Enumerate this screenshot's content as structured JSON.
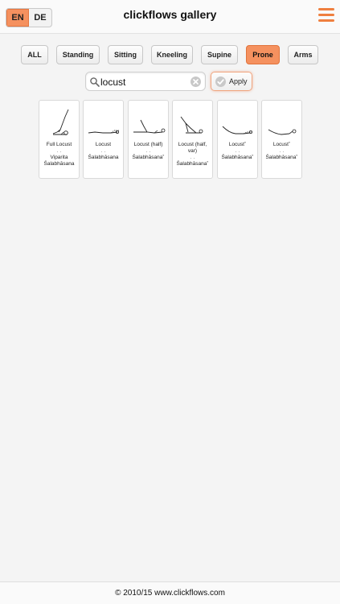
{
  "header": {
    "title": "clickflows gallery",
    "languages": [
      {
        "label": "EN",
        "active": true
      },
      {
        "label": "DE",
        "active": false
      }
    ]
  },
  "filters": [
    {
      "label": "ALL",
      "active": false
    },
    {
      "label": "Standing",
      "active": false
    },
    {
      "label": "Sitting",
      "active": false
    },
    {
      "label": "Kneeling",
      "active": false
    },
    {
      "label": "Supine",
      "active": false
    },
    {
      "label": "Prone",
      "active": true
    },
    {
      "label": "Arms",
      "active": false
    }
  ],
  "search": {
    "value": "locust",
    "apply_label": "Apply"
  },
  "poses": [
    {
      "name": "Full Locust",
      "dots": "· ·",
      "sanskrit": "Viparita Śalabhāsana"
    },
    {
      "name": "Locust",
      "dots": "· ·",
      "sanskrit": "Śalabhāsana"
    },
    {
      "name": "Locust (half)",
      "dots": "· ·",
      "sanskrit": "Śalabhāsana˚"
    },
    {
      "name": "Locust (half, var)",
      "dots": "· ·",
      "sanskrit": "Śalabhāsana˚"
    },
    {
      "name": "Locust˚",
      "dots": "· ·",
      "sanskrit": "Śalabhāsana˚"
    },
    {
      "name": "Locust˚",
      "dots": "· ·",
      "sanskrit": "Śalabhāsana˚"
    }
  ],
  "footer": {
    "text": "© 2010/15 www.clickflows.com"
  },
  "colors": {
    "accent": "#f5915f",
    "menu_icon": "#ef7f3f"
  }
}
